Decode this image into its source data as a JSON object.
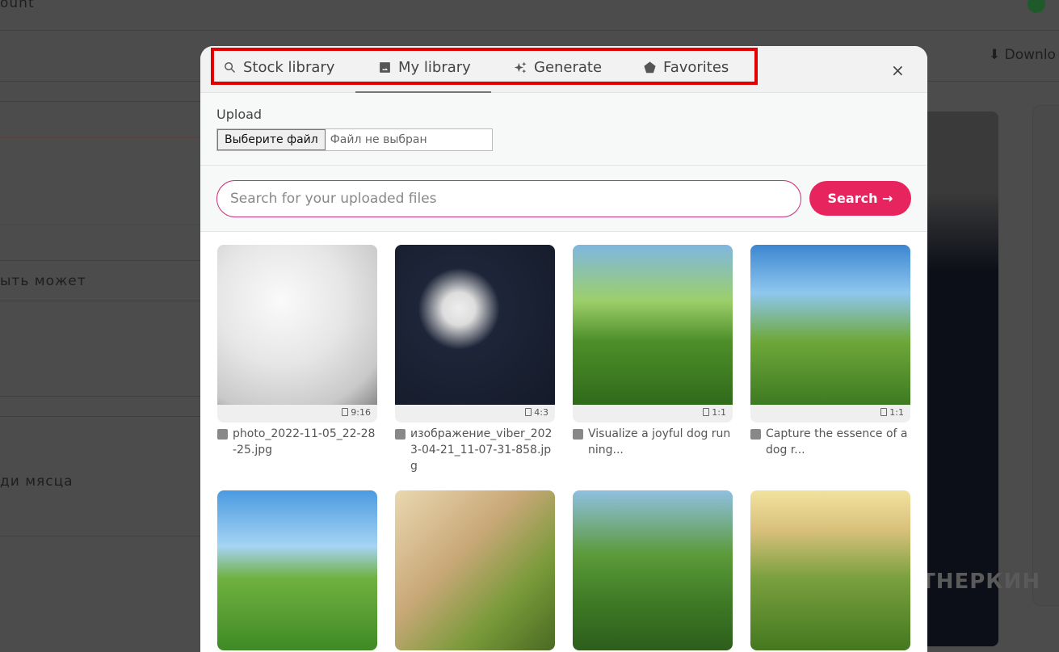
{
  "background": {
    "top_text": "ount",
    "download_label": "Downlo",
    "row_text_1": "ыть может",
    "row_text_2": "ди мясца",
    "watermark": "ТНЕРКИН"
  },
  "modal": {
    "tabs": [
      {
        "label": "Stock library",
        "icon": "search-icon"
      },
      {
        "label": "My library",
        "icon": "image-icon",
        "active": true
      },
      {
        "label": "Generate",
        "icon": "sparkle-icon"
      },
      {
        "label": "Favorites",
        "icon": "pentagon-icon"
      }
    ],
    "close_label": "×",
    "upload": {
      "label": "Upload",
      "button": "Выберите файл",
      "status": "Файл не выбран"
    },
    "search": {
      "placeholder": "Search for your uploaded files",
      "button": "Search →"
    },
    "items": [
      {
        "ratio": "9:16",
        "name": "photo_2022-11-05_22-28-25.jpg"
      },
      {
        "ratio": "4:3",
        "name": "изображение_viber_2023-04-21_11-07-31-858.jpg"
      },
      {
        "ratio": "1:1",
        "name": "Visualize a joyful dog running..."
      },
      {
        "ratio": "1:1",
        "name": "Capture the essence of a dog r..."
      },
      {
        "ratio": "",
        "name": ""
      },
      {
        "ratio": "",
        "name": ""
      },
      {
        "ratio": "",
        "name": ""
      },
      {
        "ratio": "",
        "name": ""
      }
    ]
  },
  "colors": {
    "accent": "#e8245f",
    "highlight": "#e30000"
  }
}
